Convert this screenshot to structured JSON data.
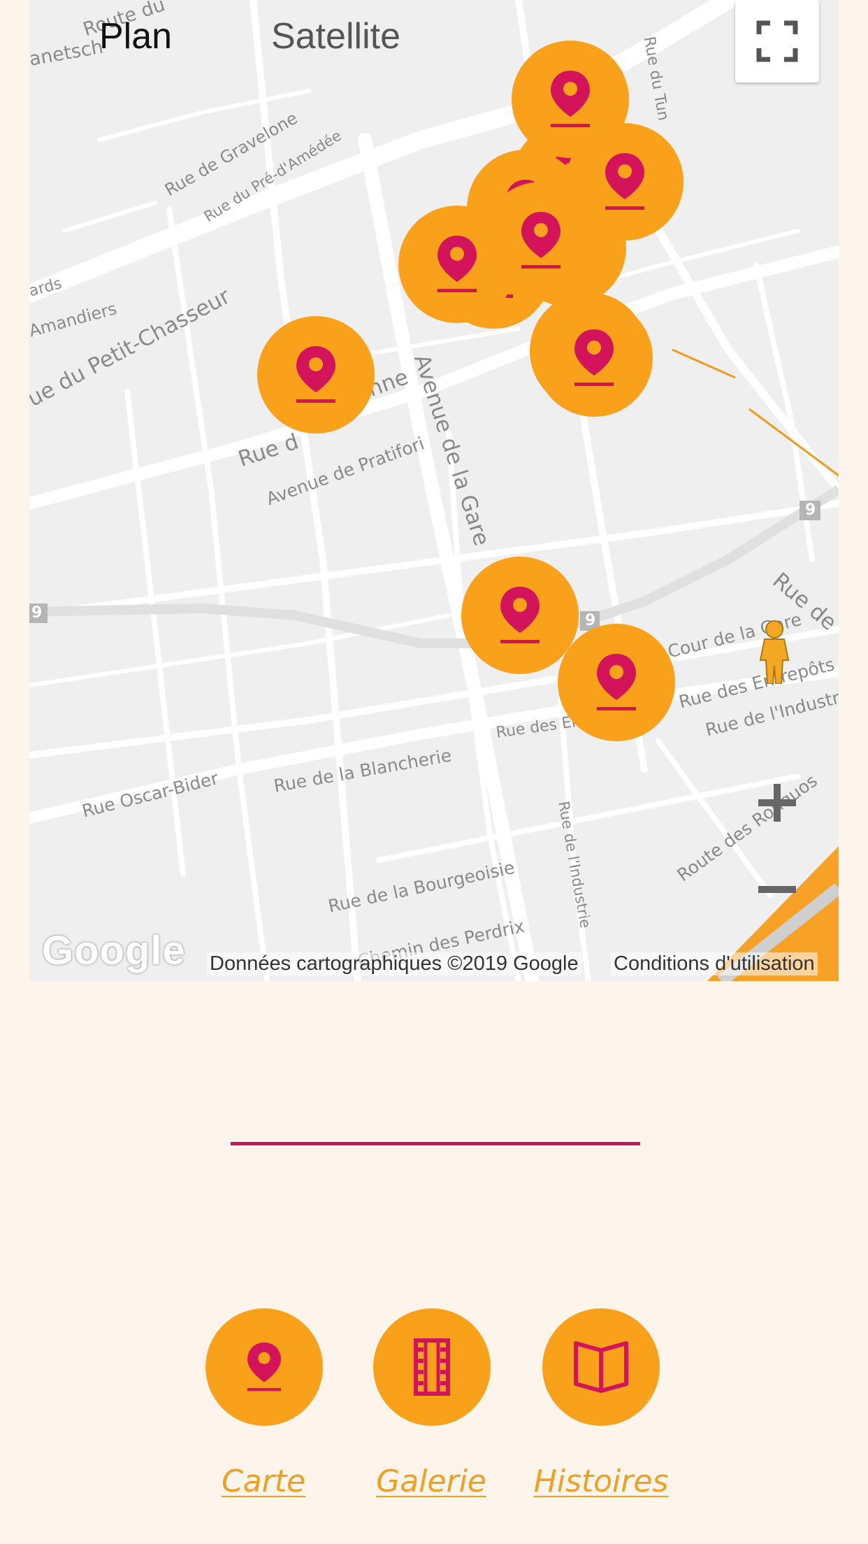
{
  "map": {
    "tabs": [
      "Plan",
      "Satellite"
    ],
    "active_tab": "Plan",
    "attribution": "Données cartographiques ©2019 Google",
    "terms": "Conditions d'utilisation",
    "logo": "Google",
    "streets": {
      "s1": "Route du",
      "s2": "anetsch",
      "s3": "Rue de Gravelone",
      "s4": "Rue du Pré-d'Amédée",
      "s5": "Rue du Tun",
      "s6": "ards",
      "s7": "Amandiers",
      "s8": "ue du Petit-Chasseur",
      "s9": "Rue d",
      "s10": "nne",
      "s11": "Avenue de la Gare",
      "s12": "Avenue de Pratifori",
      "s13": "Rue de",
      "s14": "Cour de la Gare",
      "s15": "Rue des Entrepôts",
      "s16": "Rue de l'Industrie",
      "s17": "Rue des En",
      "s18": "Rue Oscar-Bider",
      "s19": "Rue de la Blancherie",
      "s20": "Rue de la Bourgeoisie",
      "s21": "Rue de l'Industrie",
      "s22": "Route des Ronquos",
      "s23": "Chemin des Perdrix",
      "r1": "9",
      "r2": "9",
      "r3": "9"
    },
    "icons": {
      "fullscreen": "fullscreen-icon",
      "zoom_in": "plus-icon",
      "zoom_out": "minus-icon",
      "pegman": "pegman-icon",
      "marker": "map-pin-icon"
    }
  },
  "nav": {
    "items": [
      {
        "label": "Carte",
        "icon": "map-pin-icon"
      },
      {
        "label": "Galerie",
        "icon": "film-strip-icon"
      },
      {
        "label": "Histoires",
        "icon": "open-book-icon"
      }
    ]
  },
  "colors": {
    "accent_orange": "#f9a11b",
    "accent_pink": "#c8185a",
    "background": "#fdf5ec"
  }
}
